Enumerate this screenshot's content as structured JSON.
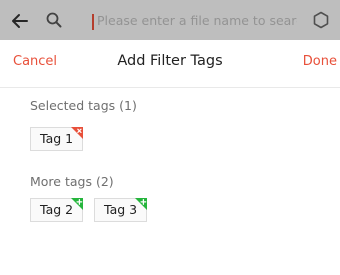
{
  "search": {
    "placeholder": "Please enter a file name to searc"
  },
  "sheet": {
    "cancel_label": "Cancel",
    "title": "Add Filter Tags",
    "done_label": "Done"
  },
  "selected": {
    "heading": "Selected tags (1)",
    "tags": [
      {
        "label": "Tag 1",
        "badge": "remove",
        "badge_color": "#e8503a"
      }
    ]
  },
  "more": {
    "heading": "More tags (2)",
    "tags": [
      {
        "label": "Tag 2",
        "badge": "add",
        "badge_color": "#25b53c"
      },
      {
        "label": "Tag 3",
        "badge": "add",
        "badge_color": "#25b53c"
      }
    ]
  },
  "colors": {
    "accent": "#e8503a",
    "add": "#25b53c"
  }
}
